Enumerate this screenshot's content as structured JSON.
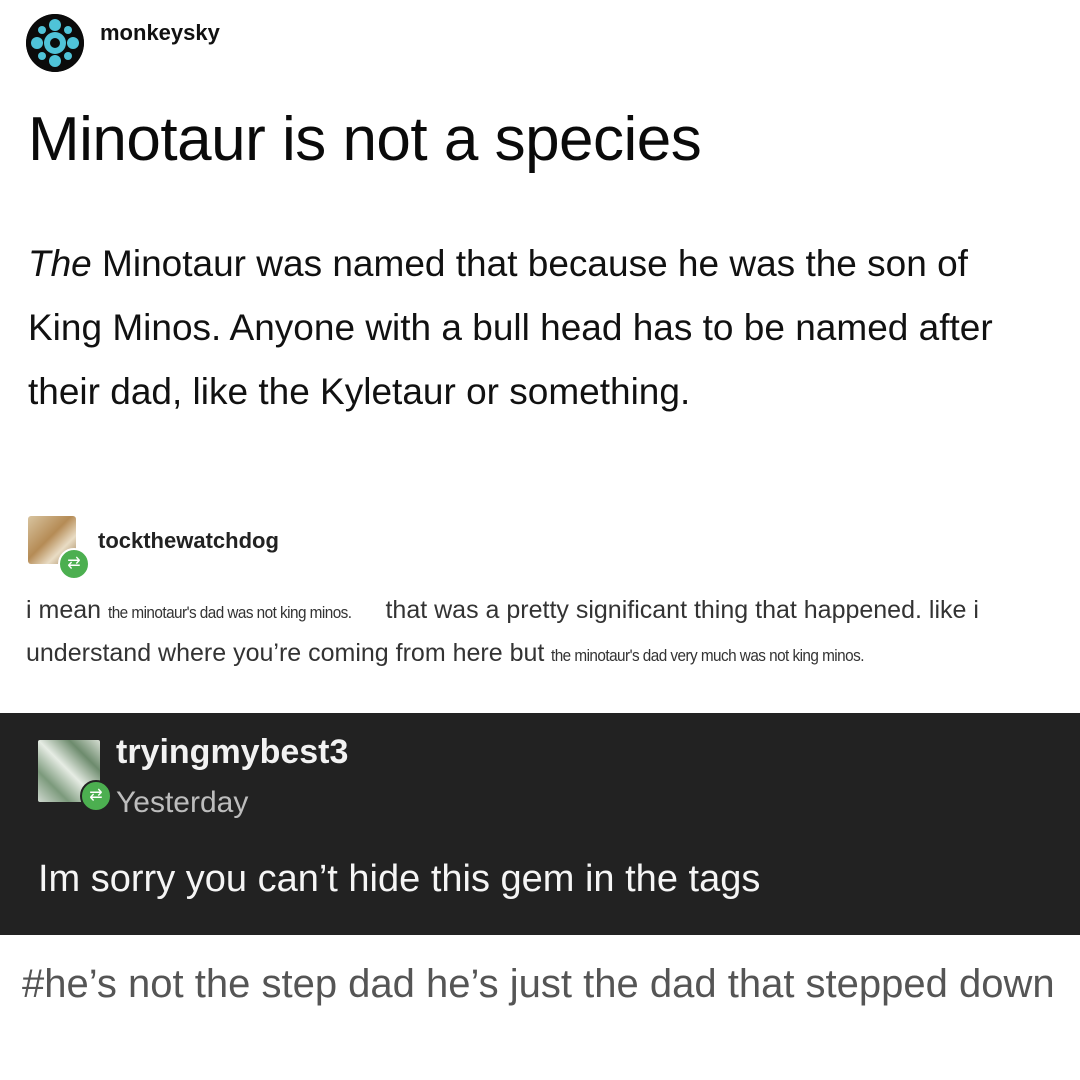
{
  "post": {
    "username": "monkeysky",
    "title": "Minotaur is not a species",
    "body_lead_italic": "The",
    "body_rest": " Minotaur was named that because he was the son of King Minos. Anyone with a bull head has to be named after their dad, like the Kyletaur or something."
  },
  "reblog": {
    "username": "tockthewatchdog",
    "badge_icon": "reblog-icon",
    "text_1": "i mean ",
    "text_2_small": "the minotaur's dad was not king minos.",
    "text_3": " that was a pretty significant thing that happened. like i understand where you’re coming from here but ",
    "text_4_small": "the minotaur's dad very much was not king minos."
  },
  "reply": {
    "username": "tryingmybest3",
    "timestamp": "Yesterday",
    "body": "Im sorry you can’t hide this gem in the tags",
    "badge_icon": "reblog-icon",
    "background": "#222222"
  },
  "tags": {
    "text": "#he’s not the step dad he’s just the dad that stepped down"
  }
}
